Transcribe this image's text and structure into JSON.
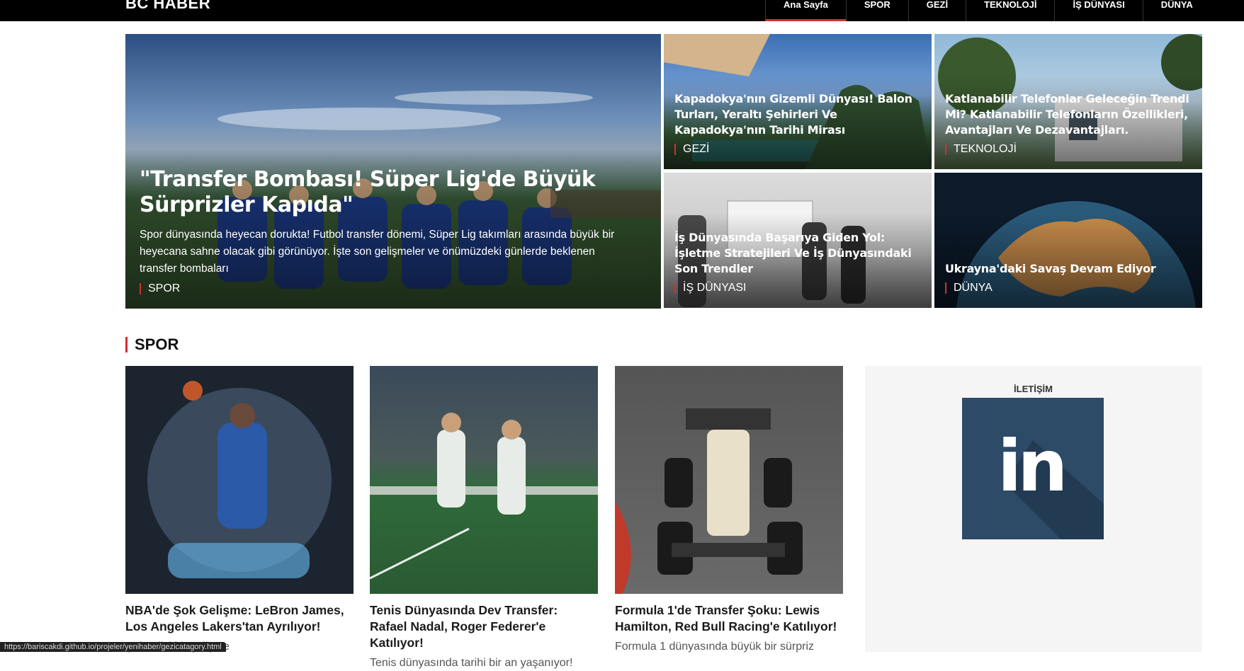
{
  "header": {
    "logo": "BC HABER",
    "nav": [
      "Ana Sayfa",
      "SPOR",
      "GEZİ",
      "TEKNOLOJİ",
      "İŞ DÜNYASI",
      "DÜNYA"
    ]
  },
  "hero": {
    "main": {
      "title": "\"Transfer Bombası! Süper Lig'de Büyük Sürprizler Kapıda\"",
      "description": "Spor dünyasında heyecan dorukta! Futbol transfer dönemi, Süper Lig takımları arasında büyük bir heyecana sahne olacak gibi görünüyor. İşte son gelişmeler ve önümüzdeki günlerde beklenen transfer bombaları",
      "category": "SPOR"
    },
    "cards": [
      {
        "title": "Kapadokya'nın Gizemli Dünyası! Balon Turları, Yeraltı Şehirleri Ve Kapadokya'nın Tarihi Mirası",
        "category": "GEZİ"
      },
      {
        "title": "Katlanabilir Telefonlar Geleceğin Trendi Mi? Katlanabilir Telefonların Özellikleri, Avantajları Ve Dezavantajları.",
        "category": "TEKNOLOJİ"
      },
      {
        "title": "İş Dünyasında Başarıya Giden Yol: İşletme Stratejileri Ve İş Dünyasındaki Son Trendler",
        "category": "İŞ DÜNYASI"
      },
      {
        "title": "Ukrayna'daki Savaş Devam Ediyor",
        "category": "DÜNYA"
      }
    ]
  },
  "section": {
    "title": "SPOR",
    "articles": [
      {
        "title": "NBA'de Şok Gelişme: LeBron James, Los Angeles Lakers'tan Ayrılıyor!",
        "description": "Şok edici bir gelişme"
      },
      {
        "title": "Tenis Dünyasında Dev Transfer: Rafael Nadal, Roger Federer'e Katılıyor!",
        "description": "Tenis dünyasında tarihi bir an yaşanıyor!"
      },
      {
        "title": "Formula 1'de Transfer Şoku: Lewis Hamilton, Red Bull Racing'e Katılıyor!",
        "description": "Formula 1 dünyasında büyük bir sürpriz"
      }
    ]
  },
  "sidebar": {
    "label": "İLETİŞİM",
    "linkedin_text": "in"
  },
  "status_url": "https://bariscakdi.github.io/projeler/yenihaber/gezicatagory.html",
  "colors": {
    "accent": "#d32f2f",
    "topbar": "#000000",
    "linkedin": "#2d4a66"
  }
}
